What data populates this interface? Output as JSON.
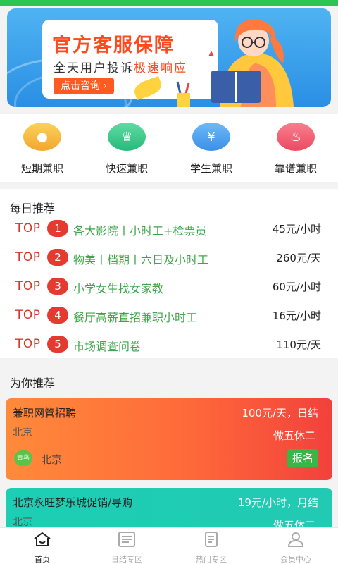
{
  "banner": {
    "headline": "官方客服保障",
    "sub_prefix": "全天用户投诉",
    "sub_highlight": "极速响应",
    "consult_label": "点击咨询 ›"
  },
  "categories": [
    {
      "label": "短期兼职",
      "icon": "short-term-icon",
      "color": "#f7b43a"
    },
    {
      "label": "快速兼职",
      "icon": "crown-icon",
      "color": "#35c98a"
    },
    {
      "label": "学生兼职",
      "icon": "money-bag-icon",
      "color": "#4aa3f0"
    },
    {
      "label": "靠谱兼职",
      "icon": "flame-icon",
      "color": "#f0526a"
    }
  ],
  "daily": {
    "title": "每日推荐",
    "items": [
      {
        "top": "TOP",
        "num": "1",
        "title": "各大影院丨小时工+检票员",
        "pay": "45元/小时"
      },
      {
        "top": "TOP",
        "num": "2",
        "title": "物美丨档期丨六日及小时工",
        "pay": "260元/天"
      },
      {
        "top": "TOP",
        "num": "3",
        "title": "小学女生找女家教",
        "pay": "60元/小时"
      },
      {
        "top": "TOP",
        "num": "4",
        "title": "餐厅高薪直招兼职小时工",
        "pay": "16元/小时"
      },
      {
        "top": "TOP",
        "num": "5",
        "title": "市场调查问卷",
        "pay": "110元/天"
      }
    ]
  },
  "recommend": {
    "title": "为你推荐",
    "jobs": [
      {
        "title": "兼职网管招聘",
        "pay": "100元/天，日结",
        "city": "北京",
        "rest": "做五休二",
        "badge": "青鸟",
        "badge_city": "北京",
        "apply": "报名"
      },
      {
        "title": "北京永旺梦乐城促销/导购",
        "pay": "19元/小时，月结",
        "city": "北京",
        "rest": "做五休二"
      }
    ]
  },
  "tabs": [
    {
      "label": "首页",
      "icon": "home-icon",
      "active": true
    },
    {
      "label": "日结专区",
      "icon": "list-icon"
    },
    {
      "label": "热门专区",
      "icon": "document-icon"
    },
    {
      "label": "会员中心",
      "icon": "user-icon"
    }
  ]
}
